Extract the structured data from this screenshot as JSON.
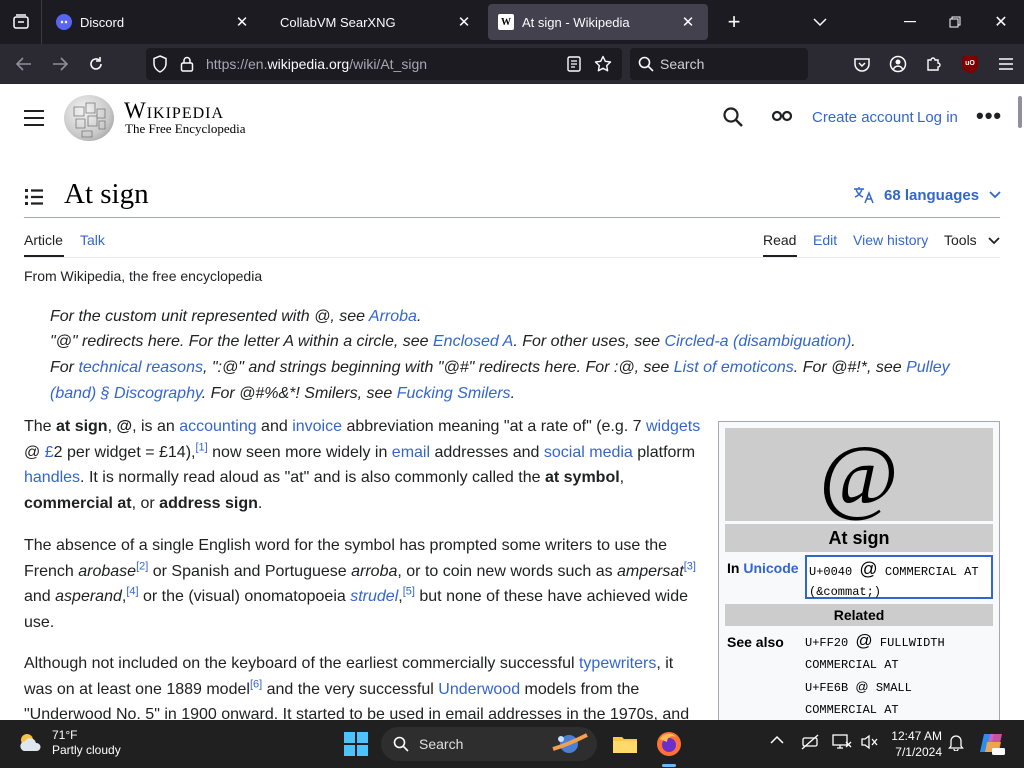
{
  "browser": {
    "tabs": [
      {
        "title": "Discord",
        "favicon": "discord-icon",
        "active": false
      },
      {
        "title": "CollabVM SearXNG",
        "favicon": "none",
        "active": false
      },
      {
        "title": "At sign - Wikipedia",
        "favicon": "wikipedia-icon",
        "active": true
      }
    ],
    "url_prefix": "https://en.",
    "url_domain": "wikipedia.org",
    "url_path": "/wiki/At_sign",
    "search_placeholder": "Search",
    "ublock_badge": "uO"
  },
  "wiki": {
    "wordmark": "Wikipedia",
    "tagline": "The Free Encyclopedia",
    "create_account": "Create account",
    "log_in": "Log in",
    "page_title": "At sign",
    "languages": "68 languages",
    "tabs_left": [
      "Article",
      "Talk"
    ],
    "tabs_right": [
      "Read",
      "Edit",
      "View history",
      "Tools"
    ],
    "from": "From Wikipedia, the free encyclopedia"
  },
  "hatnotes": {
    "h1_a": "For the custom unit represented with @, see ",
    "h1_link": "Arroba",
    "h1_b": ".",
    "h2_a": "\"@\" redirects here. For the letter A within a circle, see ",
    "h2_link1": "Enclosed A",
    "h2_b": ". For other uses, see ",
    "h2_link2": "Circled-a (disambiguation)",
    "h2_c": ".",
    "h3_a": "For ",
    "h3_link1": "technical reasons",
    "h3_b": ", \":@\" and strings beginning with \"@#\" redirects here. For :@, see ",
    "h3_link2": "List of emoticons",
    "h3_c": ". For @#!*, see ",
    "h3_link3": "Pulley (band) § Discography",
    "h3_d": ". For @#%&*! Smilers, see ",
    "h3_link4": "Fucking Smilers",
    "h3_e": "."
  },
  "para1": {
    "a": "The ",
    "b1": "at sign",
    "c": ", ",
    "b2": "@",
    "d": ", is an ",
    "l1": "accounting",
    "e": " and ",
    "l2": "invoice",
    "f": " abbreviation meaning \"at a rate of\" (e.g. 7 ",
    "l3": "widgets",
    "g": " @ ",
    "l4": "£",
    "h": "2 per widget = £14),",
    "ref1": "[1]",
    "i": " now seen more widely in ",
    "l5": "email",
    "j": " addresses and ",
    "l6": "social media",
    "k": " platform ",
    "l7": "handles",
    "m": ". It is normally read aloud as \"at\" and is also commonly called the ",
    "b3": "at symbol",
    "n": ", ",
    "b4": "commercial at",
    "o": ", or ",
    "b5": "address sign",
    "p": "."
  },
  "para2": {
    "a": "The absence of a single English word for the symbol has prompted some writers to use the French ",
    "i1": "arobase",
    "ref2": "[2]",
    "b": " or Spanish and Portuguese ",
    "i2": "arroba",
    "c": ", or to coin new words such as ",
    "i3": "ampersat",
    "ref3": "[3]",
    "d": " and ",
    "i4": "asperand",
    "e": ",",
    "ref4": "[4]",
    "f": " or the (visual) onomatopoeia ",
    "l1": "strudel",
    "g": ",",
    "ref5": "[5]",
    "h": " but none of these have achieved wide use."
  },
  "para3": {
    "a": "Although not included on the keyboard of the earliest commercially successful ",
    "l1": "typewriters",
    "b": ", it was on at least one 1889 model",
    "ref6": "[6]",
    "c": " and the very successful ",
    "l2": "Underwood",
    "d": " models from the \"Underwood No. 5\" in 1900 onward. It started to be used in email addresses in the 1970s, and"
  },
  "infobox": {
    "glyph": "@",
    "title": "At sign",
    "in_label": "In ",
    "unicode_link": "Unicode",
    "unicode_code": "U+0040",
    "unicode_glyph": "@",
    "unicode_name": "COMMERCIAL AT",
    "unicode_entity": "(&commat;)",
    "related_header": "Related",
    "see_also_label": "See also",
    "see_also": [
      {
        "code": "U+FF20",
        "glyph": "@",
        "name": "FULLWIDTH"
      },
      {
        "code": "",
        "glyph": "",
        "name": "COMMERCIAL AT"
      },
      {
        "code": "U+FE6B",
        "glyph": "@",
        "name": "SMALL"
      },
      {
        "code": "",
        "glyph": "",
        "name": "COMMERCIAL AT"
      }
    ]
  },
  "taskbar": {
    "temp": "71°F",
    "condition": "Partly cloudy",
    "search_label": "Search",
    "time": "12:47 AM",
    "date": "7/1/2024"
  },
  "colors": {
    "link": "#3366cc",
    "chrome_dark": "#1c1b22",
    "toolbar": "#2b2a33",
    "active_tab": "#42414d",
    "taskbar": "#202020"
  }
}
